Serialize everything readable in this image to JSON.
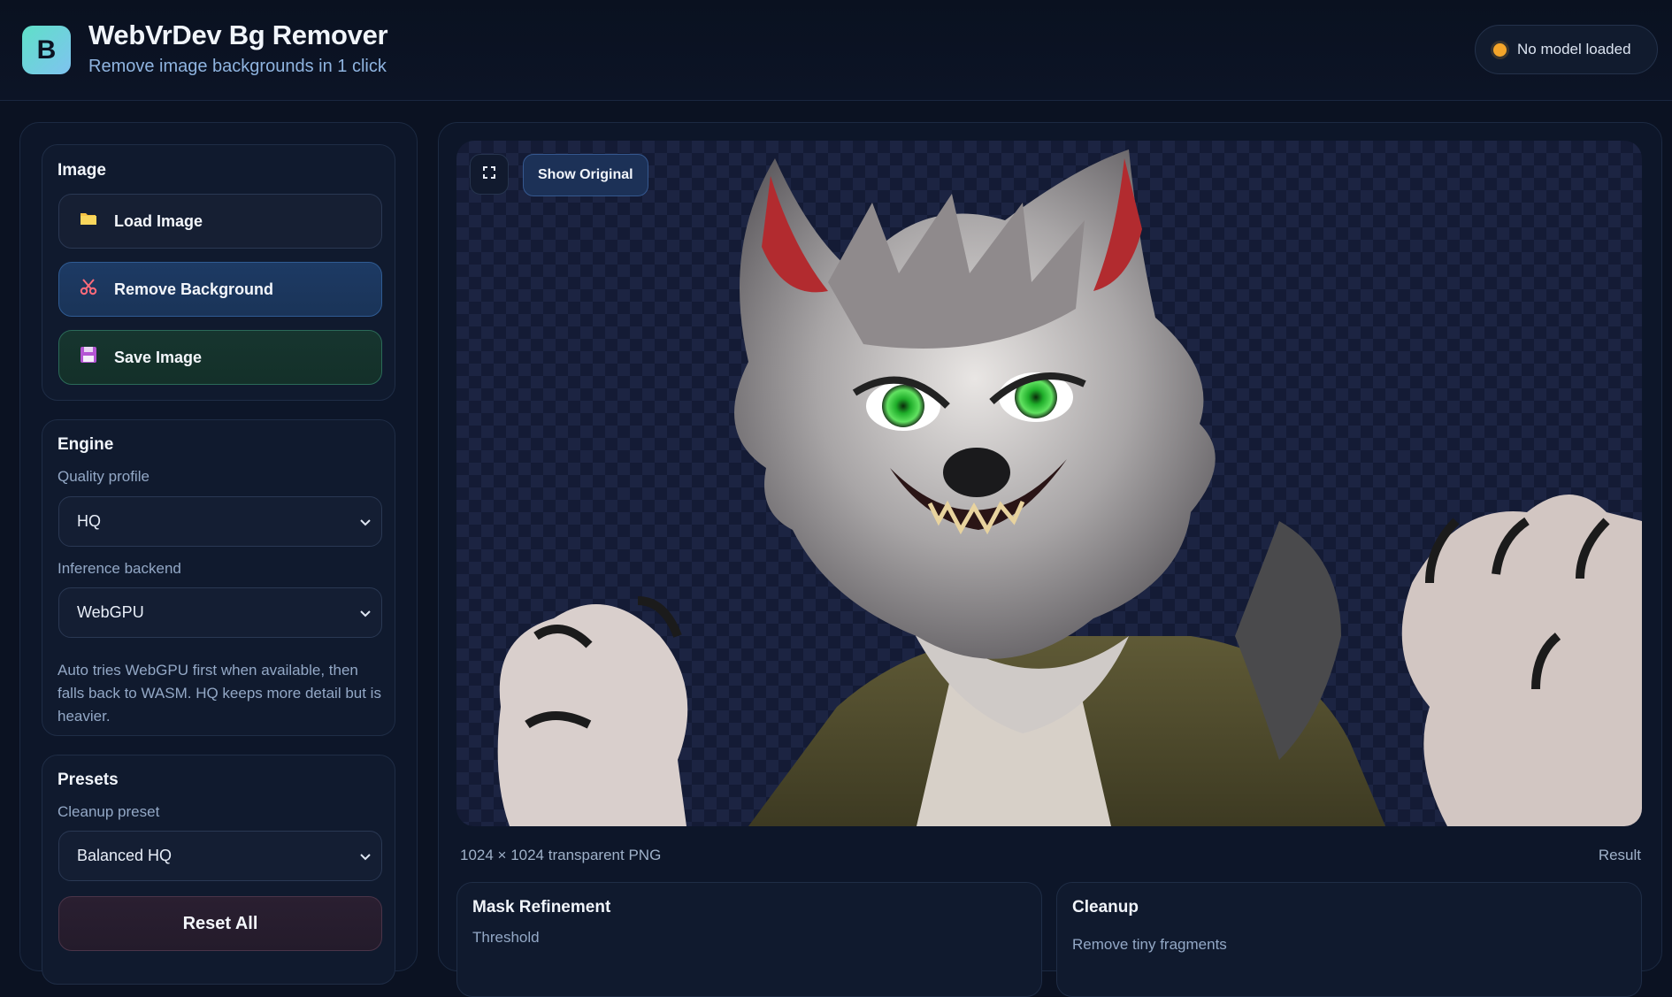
{
  "header": {
    "logo_letter": "B",
    "title": "WebVrDev Bg Remover",
    "subtitle": "Remove image backgrounds in 1 click",
    "status": "No model loaded",
    "status_color": "#f4a52a"
  },
  "sidebar": {
    "image_card": {
      "title": "Image",
      "load_label": "Load Image",
      "load_icon": "folder-icon",
      "remove_label": "Remove Background",
      "remove_icon": "scissors-icon",
      "save_label": "Save Image",
      "save_icon": "floppy-disk-icon"
    },
    "engine_card": {
      "title": "Engine",
      "quality_label": "Quality profile",
      "quality_value": "HQ",
      "backend_label": "Inference backend",
      "backend_value": "WebGPU",
      "help": "Auto tries WebGPU first when available, then falls back to WASM. HQ keeps more detail but is heavier."
    },
    "presets_card": {
      "title": "Presets",
      "preset_label": "Cleanup preset",
      "preset_value": "Balanced HQ",
      "reset_label": "Reset All"
    }
  },
  "main": {
    "show_original_label": "Show Original",
    "fullscreen_icon": "fullscreen-icon",
    "image_info": "1024 × 1024 transparent PNG",
    "view_mode": "Result",
    "mask_panel": {
      "title": "Mask Refinement",
      "first_label": "Threshold"
    },
    "cleanup_panel": {
      "title": "Cleanup",
      "first_label": "Remove tiny fragments"
    }
  },
  "colors": {
    "background": "#0b1222",
    "accent_blue": "#2f5b93",
    "accent_green": "#2b6a58",
    "reset_maroon": "#4a3448"
  }
}
